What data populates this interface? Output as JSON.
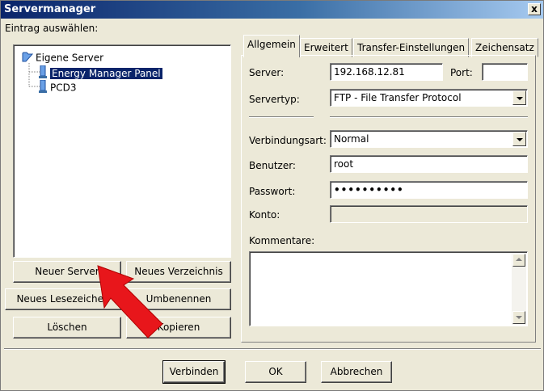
{
  "window": {
    "title": "Servermanager",
    "close_glyph": "x"
  },
  "left": {
    "select_label": "Eintrag auswählen:",
    "tree": {
      "root": "Eigene Server",
      "items": [
        {
          "label": "Energy Manager Panel",
          "selected": true
        },
        {
          "label": "PCD3",
          "selected": false
        }
      ]
    },
    "buttons": {
      "new_server": "Neuer Server",
      "new_folder": "Neues Verzeichnis",
      "new_bookmark": "Neues Lesezeichen",
      "rename": "Umbenennen",
      "delete": "Löschen",
      "copy": "Kopieren"
    }
  },
  "tabs": [
    "Allgemein",
    "Erweitert",
    "Transfer-Einstellungen",
    "Zeichensatz"
  ],
  "form": {
    "server_label": "Server:",
    "server_value": "192.168.12.81",
    "port_label": "Port:",
    "port_value": "",
    "server_type_label": "Servertyp:",
    "server_type_value": "FTP - File Transfer Protocol",
    "connection_type_label": "Verbindungsart:",
    "connection_type_value": "Normal",
    "user_label": "Benutzer:",
    "user_value": "root",
    "password_label": "Passwort:",
    "password_value": "••••••••••",
    "account_label": "Konto:",
    "account_value": "",
    "comments_label": "Kommentare:",
    "comments_value": ""
  },
  "footer": {
    "connect": "Verbinden",
    "ok": "OK",
    "cancel": "Abbrechen"
  },
  "colors": {
    "annotation_arrow": "#e8161b",
    "selection": "#0a246a"
  }
}
